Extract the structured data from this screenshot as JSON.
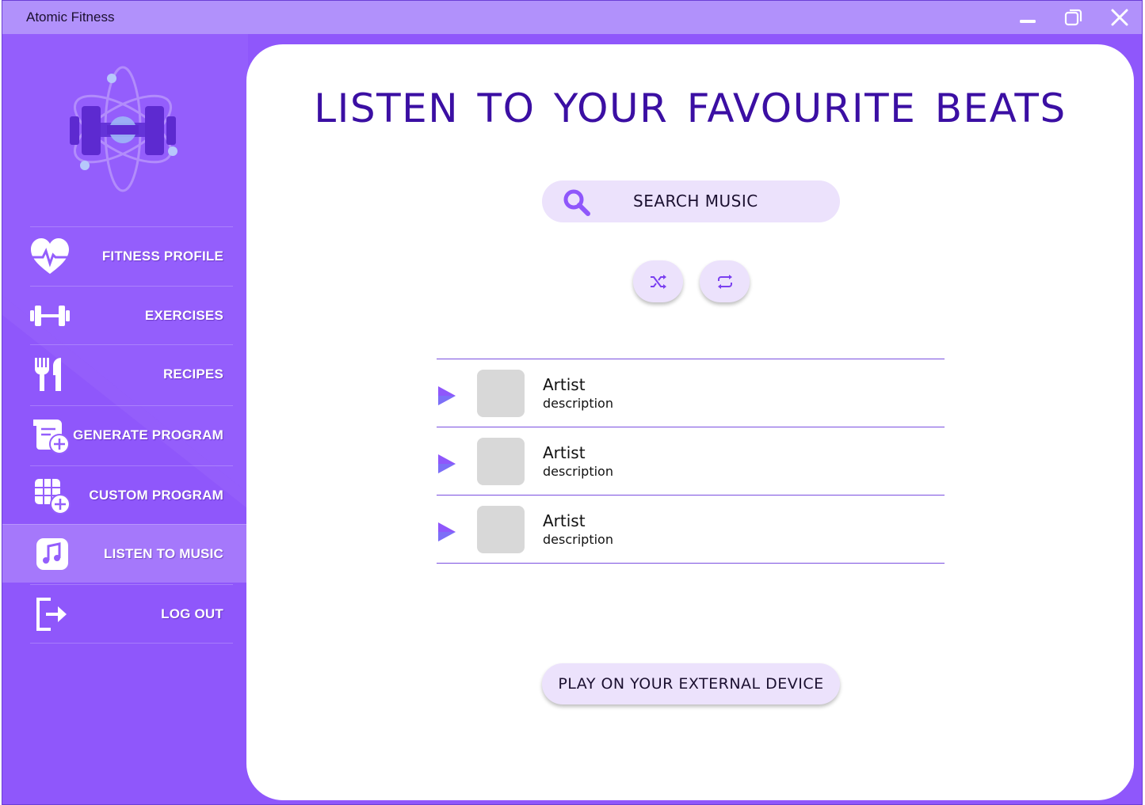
{
  "window": {
    "title": "Atomic Fitness",
    "controls": [
      "minimize-icon",
      "restore-icon",
      "close-icon"
    ]
  },
  "sidebar": {
    "logo": "atom-dumbbell-logo",
    "items": [
      {
        "label": "FITNESS PROFILE",
        "icon": "heart-pulse-icon",
        "active": false
      },
      {
        "label": "EXERCISES",
        "icon": "dumbbell-icon",
        "active": false
      },
      {
        "label": "RECIPES",
        "icon": "fork-knife-icon",
        "active": false
      },
      {
        "label": "GENERATE PROGRAM",
        "icon": "generate-program-icon",
        "active": false
      },
      {
        "label": "CUSTOM PROGRAM",
        "icon": "custom-program-icon",
        "active": false
      },
      {
        "label": "LISTEN TO MUSIC",
        "icon": "music-note-icon",
        "active": true
      },
      {
        "label": "LOG OUT",
        "icon": "logout-icon",
        "active": false
      }
    ]
  },
  "main": {
    "title": "LISTEN TO YOUR FAVOURITE BEATS",
    "search": {
      "placeholder": "SEARCH MUSIC",
      "icon": "search-icon"
    },
    "controls": [
      {
        "name": "shuffle",
        "icon": "shuffle-icon"
      },
      {
        "name": "repeat",
        "icon": "repeat-icon"
      }
    ],
    "tracks": [
      {
        "artist": "Artist",
        "description": "description"
      },
      {
        "artist": "Artist",
        "description": "description"
      },
      {
        "artist": "Artist",
        "description": "description"
      }
    ],
    "external_button": "PLAY ON YOUR EXTERNAL DEVICE"
  },
  "colors": {
    "sidebar": "#945efc",
    "titlebar": "#b191fb",
    "accent": "#3b0fa3",
    "pill": "#ece2fc",
    "play": "#8f57fb"
  }
}
